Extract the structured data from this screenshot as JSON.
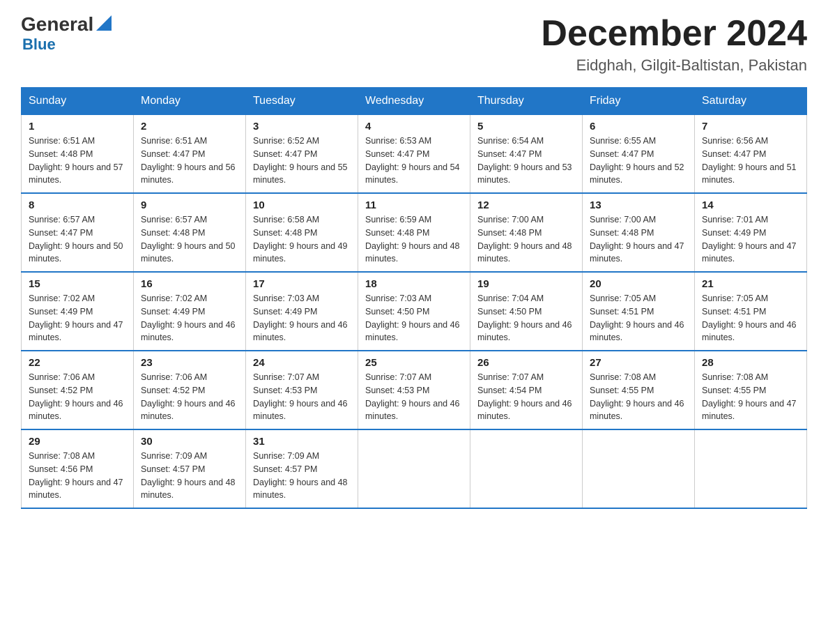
{
  "header": {
    "logo_general": "General",
    "logo_blue": "Blue",
    "month_title": "December 2024",
    "location": "Eidghah, Gilgit-Baltistan, Pakistan"
  },
  "days_of_week": [
    "Sunday",
    "Monday",
    "Tuesday",
    "Wednesday",
    "Thursday",
    "Friday",
    "Saturday"
  ],
  "weeks": [
    [
      {
        "day": "1",
        "sunrise": "6:51 AM",
        "sunset": "4:48 PM",
        "daylight": "9 hours and 57 minutes."
      },
      {
        "day": "2",
        "sunrise": "6:51 AM",
        "sunset": "4:47 PM",
        "daylight": "9 hours and 56 minutes."
      },
      {
        "day": "3",
        "sunrise": "6:52 AM",
        "sunset": "4:47 PM",
        "daylight": "9 hours and 55 minutes."
      },
      {
        "day": "4",
        "sunrise": "6:53 AM",
        "sunset": "4:47 PM",
        "daylight": "9 hours and 54 minutes."
      },
      {
        "day": "5",
        "sunrise": "6:54 AM",
        "sunset": "4:47 PM",
        "daylight": "9 hours and 53 minutes."
      },
      {
        "day": "6",
        "sunrise": "6:55 AM",
        "sunset": "4:47 PM",
        "daylight": "9 hours and 52 minutes."
      },
      {
        "day": "7",
        "sunrise": "6:56 AM",
        "sunset": "4:47 PM",
        "daylight": "9 hours and 51 minutes."
      }
    ],
    [
      {
        "day": "8",
        "sunrise": "6:57 AM",
        "sunset": "4:47 PM",
        "daylight": "9 hours and 50 minutes."
      },
      {
        "day": "9",
        "sunrise": "6:57 AM",
        "sunset": "4:48 PM",
        "daylight": "9 hours and 50 minutes."
      },
      {
        "day": "10",
        "sunrise": "6:58 AM",
        "sunset": "4:48 PM",
        "daylight": "9 hours and 49 minutes."
      },
      {
        "day": "11",
        "sunrise": "6:59 AM",
        "sunset": "4:48 PM",
        "daylight": "9 hours and 48 minutes."
      },
      {
        "day": "12",
        "sunrise": "7:00 AM",
        "sunset": "4:48 PM",
        "daylight": "9 hours and 48 minutes."
      },
      {
        "day": "13",
        "sunrise": "7:00 AM",
        "sunset": "4:48 PM",
        "daylight": "9 hours and 47 minutes."
      },
      {
        "day": "14",
        "sunrise": "7:01 AM",
        "sunset": "4:49 PM",
        "daylight": "9 hours and 47 minutes."
      }
    ],
    [
      {
        "day": "15",
        "sunrise": "7:02 AM",
        "sunset": "4:49 PM",
        "daylight": "9 hours and 47 minutes."
      },
      {
        "day": "16",
        "sunrise": "7:02 AM",
        "sunset": "4:49 PM",
        "daylight": "9 hours and 46 minutes."
      },
      {
        "day": "17",
        "sunrise": "7:03 AM",
        "sunset": "4:49 PM",
        "daylight": "9 hours and 46 minutes."
      },
      {
        "day": "18",
        "sunrise": "7:03 AM",
        "sunset": "4:50 PM",
        "daylight": "9 hours and 46 minutes."
      },
      {
        "day": "19",
        "sunrise": "7:04 AM",
        "sunset": "4:50 PM",
        "daylight": "9 hours and 46 minutes."
      },
      {
        "day": "20",
        "sunrise": "7:05 AM",
        "sunset": "4:51 PM",
        "daylight": "9 hours and 46 minutes."
      },
      {
        "day": "21",
        "sunrise": "7:05 AM",
        "sunset": "4:51 PM",
        "daylight": "9 hours and 46 minutes."
      }
    ],
    [
      {
        "day": "22",
        "sunrise": "7:06 AM",
        "sunset": "4:52 PM",
        "daylight": "9 hours and 46 minutes."
      },
      {
        "day": "23",
        "sunrise": "7:06 AM",
        "sunset": "4:52 PM",
        "daylight": "9 hours and 46 minutes."
      },
      {
        "day": "24",
        "sunrise": "7:07 AM",
        "sunset": "4:53 PM",
        "daylight": "9 hours and 46 minutes."
      },
      {
        "day": "25",
        "sunrise": "7:07 AM",
        "sunset": "4:53 PM",
        "daylight": "9 hours and 46 minutes."
      },
      {
        "day": "26",
        "sunrise": "7:07 AM",
        "sunset": "4:54 PM",
        "daylight": "9 hours and 46 minutes."
      },
      {
        "day": "27",
        "sunrise": "7:08 AM",
        "sunset": "4:55 PM",
        "daylight": "9 hours and 46 minutes."
      },
      {
        "day": "28",
        "sunrise": "7:08 AM",
        "sunset": "4:55 PM",
        "daylight": "9 hours and 47 minutes."
      }
    ],
    [
      {
        "day": "29",
        "sunrise": "7:08 AM",
        "sunset": "4:56 PM",
        "daylight": "9 hours and 47 minutes."
      },
      {
        "day": "30",
        "sunrise": "7:09 AM",
        "sunset": "4:57 PM",
        "daylight": "9 hours and 48 minutes."
      },
      {
        "day": "31",
        "sunrise": "7:09 AM",
        "sunset": "4:57 PM",
        "daylight": "9 hours and 48 minutes."
      },
      null,
      null,
      null,
      null
    ]
  ]
}
